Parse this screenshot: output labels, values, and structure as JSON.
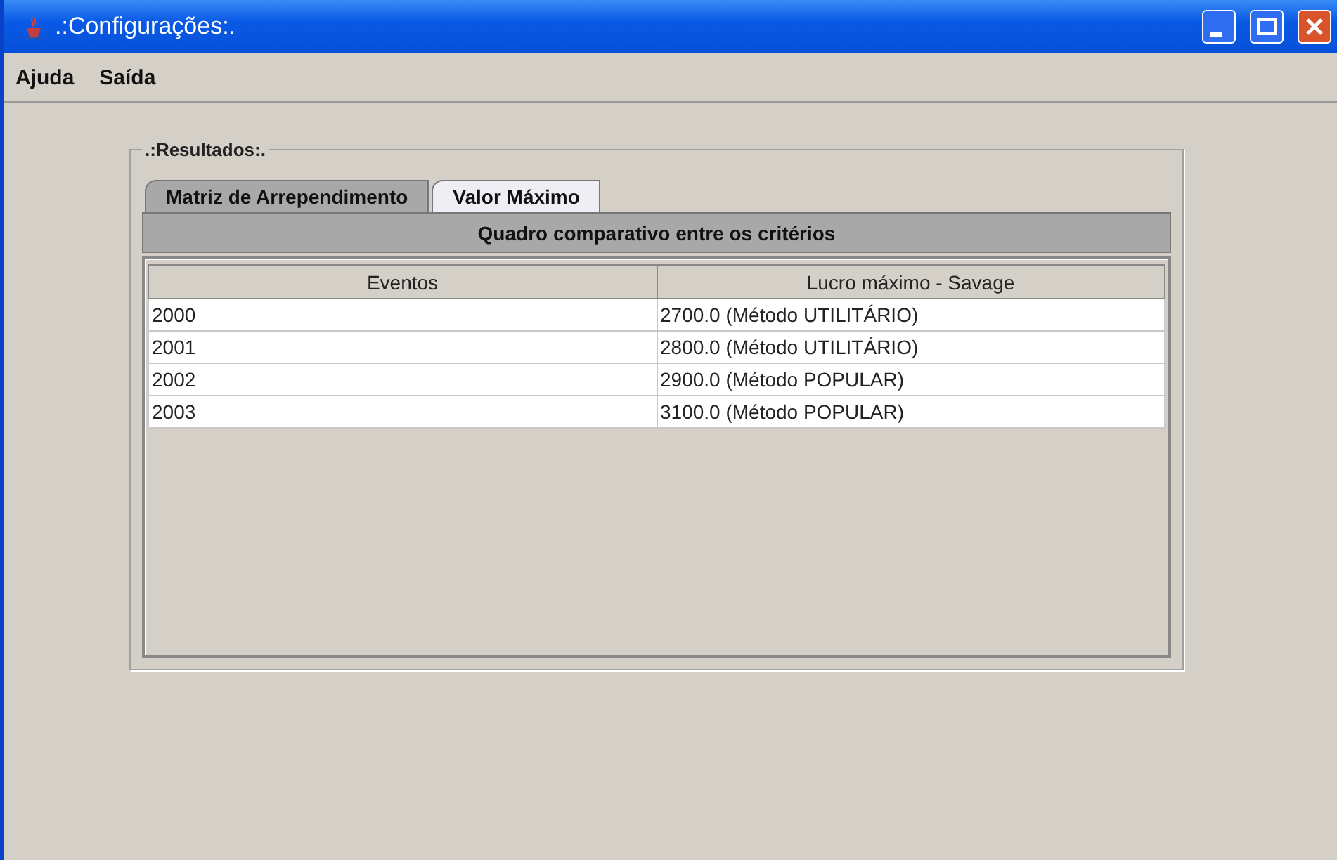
{
  "window": {
    "title": ".:Configurações:."
  },
  "menu": [
    "Ajuda",
    "Saída"
  ],
  "group": {
    "title": ".:Resultados:."
  },
  "tabs": [
    {
      "label": "Matriz de Arrependimento",
      "selected": true
    },
    {
      "label": "Valor Máximo",
      "selected": false
    }
  ],
  "panel_header": "Quadro comparativo entre os critérios",
  "table": {
    "columns": [
      "Eventos",
      "Lucro máximo - Savage"
    ],
    "rows": [
      [
        "2000",
        "2700.0 (Método UTILITÁRIO)"
      ],
      [
        "2001",
        "2800.0 (Método UTILITÁRIO)"
      ],
      [
        "2002",
        "2900.0 (Método POPULAR)"
      ],
      [
        "2003",
        "3100.0 (Método POPULAR)"
      ]
    ]
  }
}
